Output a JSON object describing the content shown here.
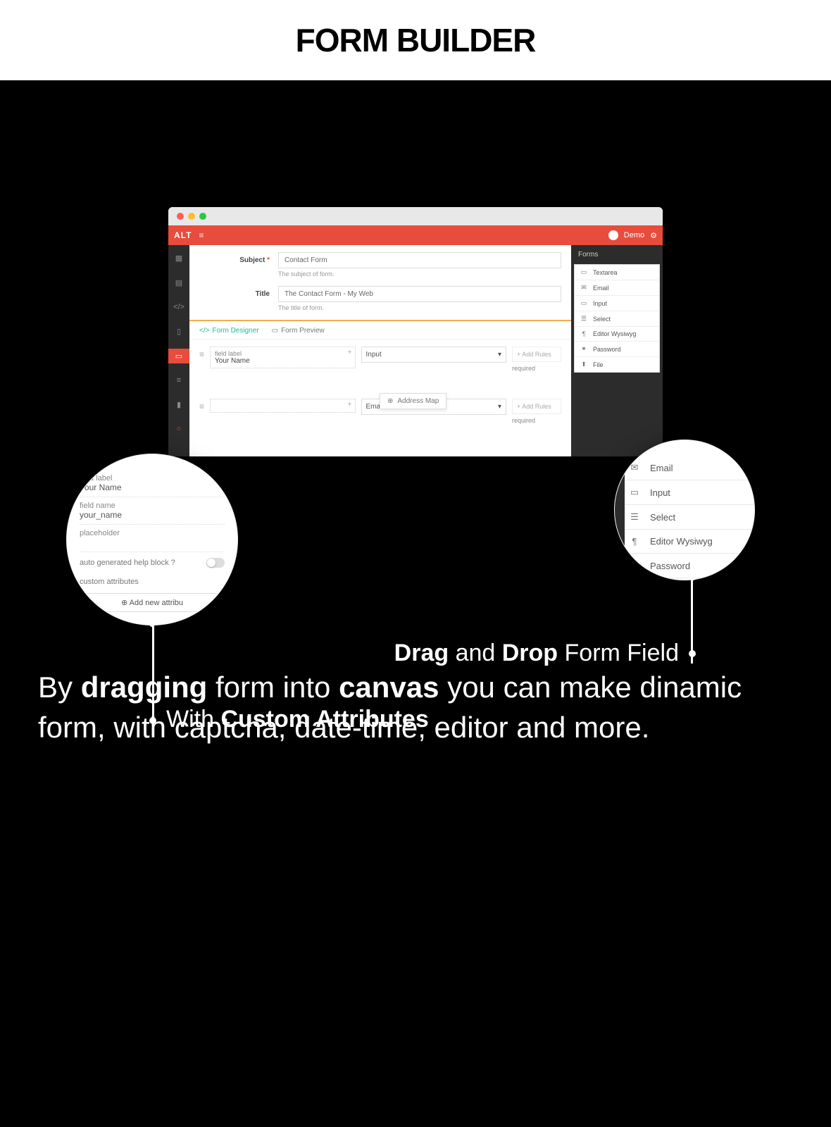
{
  "hero": {
    "title": "FORM BUILDER"
  },
  "topbar": {
    "logo": "ALT",
    "user": "Demo"
  },
  "form": {
    "subject_label": "Subject",
    "subject_value": "Contact Form",
    "subject_help": "The subject of form.",
    "title_label": "Title",
    "title_value": "The Contact Form - My Web",
    "title_help": "The title of form."
  },
  "tabs": {
    "designer": "Form Designer",
    "preview": "Form Preview"
  },
  "designer": {
    "field_label_lbl": "field label",
    "field_label_val": "Your Name",
    "select1": "Input",
    "select2": "Email",
    "add_rules": "+ Add Rules",
    "required": "required",
    "address": "Address Map"
  },
  "panel": {
    "title": "Forms",
    "items": [
      "Textarea",
      "Email",
      "Input",
      "Select",
      "Editor Wysiwyg",
      "Password",
      "File"
    ]
  },
  "mag_left": {
    "field_label_lbl": "field label",
    "field_label_val": "Your Name",
    "field_name_lbl": "field name",
    "field_name_val": "your_name",
    "placeholder_lbl": "placeholder",
    "help_block": "auto generated help block ?",
    "custom_attr": "custom attributes",
    "add_btn": "Add new attribu"
  },
  "mag_right": {
    "items": [
      "Email",
      "Input",
      "Select",
      "Editor Wysiwyg",
      "Password"
    ]
  },
  "callouts": {
    "right_a": "Drag",
    "right_b": " and ",
    "right_c": "Drop",
    "right_d": " Form Field",
    "left_a": "With ",
    "left_b": "Custom Attributes"
  },
  "desc": {
    "a": "By ",
    "b": "dragging",
    "c": " form into ",
    "d": "canvas",
    "e": " you can make dinamic form, with captcha, date-time, editor and more."
  }
}
